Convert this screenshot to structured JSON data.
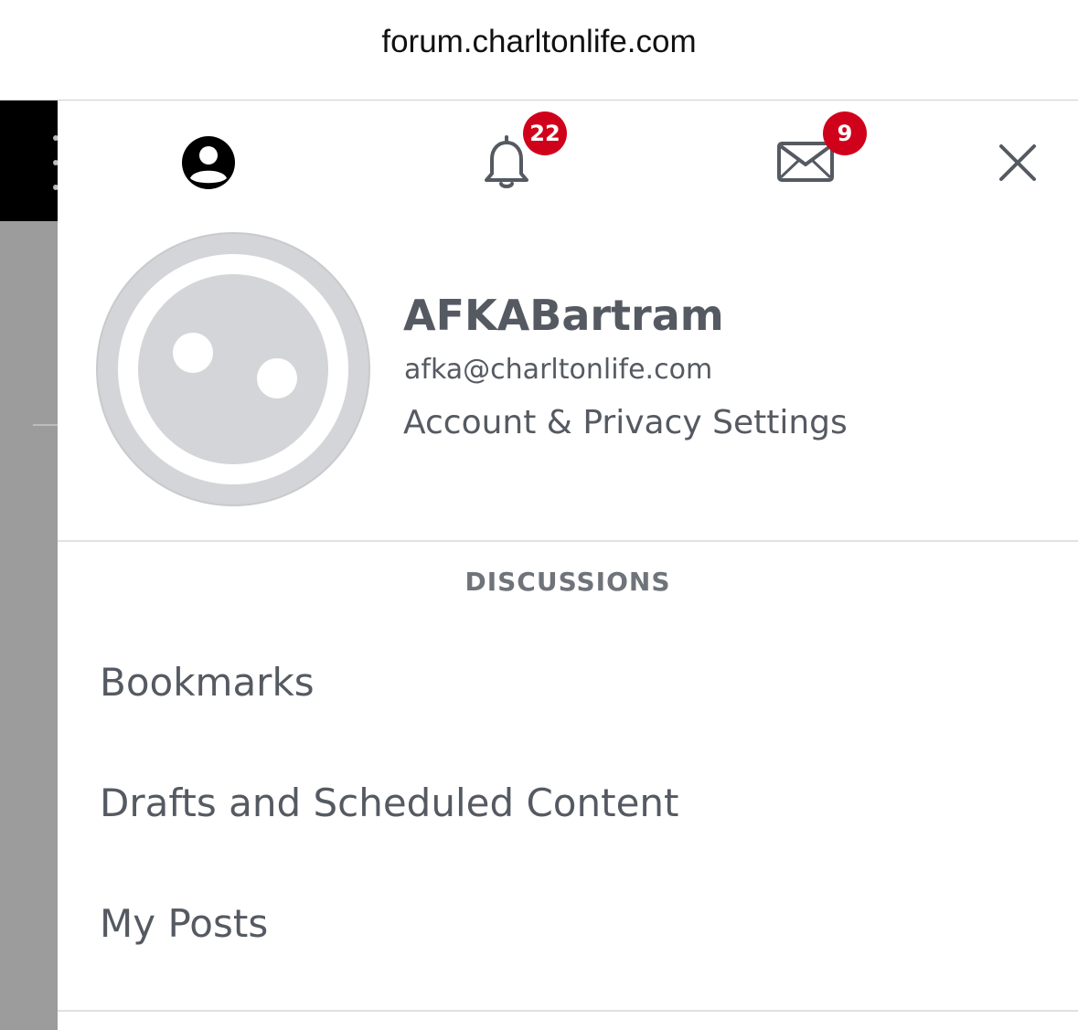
{
  "browser": {
    "url": "forum.charltonlife.com"
  },
  "header": {
    "profile_icon": "account-circle-icon",
    "notifications": {
      "icon": "bell-icon",
      "count": "22"
    },
    "messages": {
      "icon": "envelope-icon",
      "count": "9"
    },
    "close_icon": "close-icon"
  },
  "profile": {
    "avatar_icon": "default-avatar",
    "username": "AFKABartram",
    "email": "afka@charltonlife.com",
    "settings_label": "Account & Privacy Settings"
  },
  "discussions": {
    "header": "DISCUSSIONS",
    "items": [
      {
        "label": "Bookmarks"
      },
      {
        "label": "Drafts and Scheduled Content"
      },
      {
        "label": "My Posts"
      }
    ]
  },
  "colors": {
    "badge": "#d0021b",
    "text": "#555a62",
    "avatar": "#d4d5d8"
  }
}
